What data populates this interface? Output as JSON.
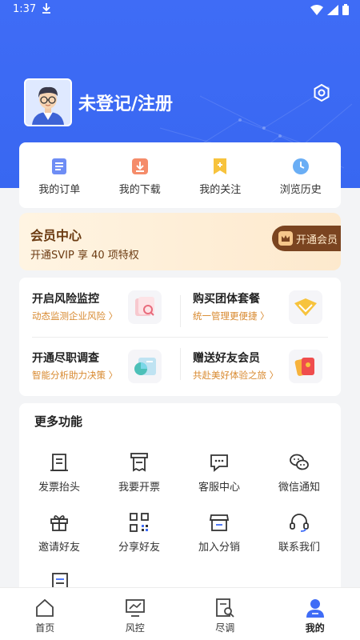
{
  "status": {
    "time": "1:37"
  },
  "profile": {
    "login_text": "未登记/注册"
  },
  "quick_links": [
    {
      "label": "我的订单",
      "icon": "order-icon"
    },
    {
      "label": "我的下载",
      "icon": "download-icon"
    },
    {
      "label": "我的关注",
      "icon": "bookmark-icon"
    },
    {
      "label": "浏览历史",
      "icon": "clock-icon"
    }
  ],
  "vip": {
    "title": "会员中心",
    "subtitle": "开通SVIP 享 40 项特权",
    "button": "开通会员"
  },
  "services": [
    {
      "title": "开启风险监控",
      "subtitle": "动态监测企业风险 〉"
    },
    {
      "title": "购买团体套餐",
      "subtitle": "统一管理更便捷 〉"
    },
    {
      "title": "开通尽职调查",
      "subtitle": "智能分析助力决策 〉"
    },
    {
      "title": "赠送好友会员",
      "subtitle": "共赴美好体验之旅 〉"
    }
  ],
  "more": {
    "title": "更多功能",
    "items": [
      {
        "label": "发票抬头",
        "icon": "invoice-title-icon"
      },
      {
        "label": "我要开票",
        "icon": "invoice-icon"
      },
      {
        "label": "客服中心",
        "icon": "chat-icon"
      },
      {
        "label": "微信通知",
        "icon": "wechat-icon"
      },
      {
        "label": "邀请好友",
        "icon": "gift-icon"
      },
      {
        "label": "分享好友",
        "icon": "qrcode-icon"
      },
      {
        "label": "加入分销",
        "icon": "store-icon"
      },
      {
        "label": "联系我们",
        "icon": "headset-icon"
      }
    ]
  },
  "tabs": [
    {
      "label": "首页",
      "icon": "home-icon"
    },
    {
      "label": "风控",
      "icon": "monitor-icon"
    },
    {
      "label": "尽调",
      "icon": "report-search-icon"
    },
    {
      "label": "我的",
      "icon": "user-icon",
      "active": true
    }
  ],
  "colors": {
    "primary": "#3f6cf6",
    "vip_brown": "#7a4420",
    "orange_sub": "#d8892f"
  }
}
